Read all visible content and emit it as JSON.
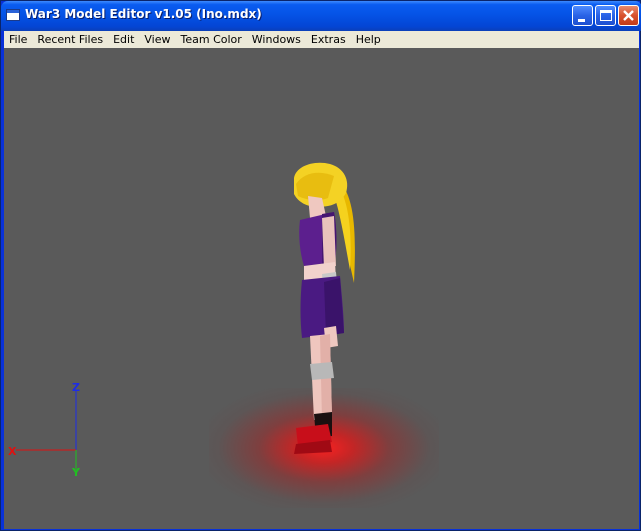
{
  "window": {
    "title": "War3 Model Editor v1.05 (Ino.mdx)"
  },
  "menu": {
    "items": [
      "File",
      "Recent Files",
      "Edit",
      "View",
      "Team Color",
      "Windows",
      "Extras",
      "Help"
    ]
  },
  "viewport": {
    "background": "#5a5a5a",
    "axes": {
      "x_label": "X",
      "y_label": "Y",
      "z_label": "Z",
      "x_color": "#e01010",
      "y_color": "#20c020",
      "z_color": "#1c2ce8"
    }
  }
}
